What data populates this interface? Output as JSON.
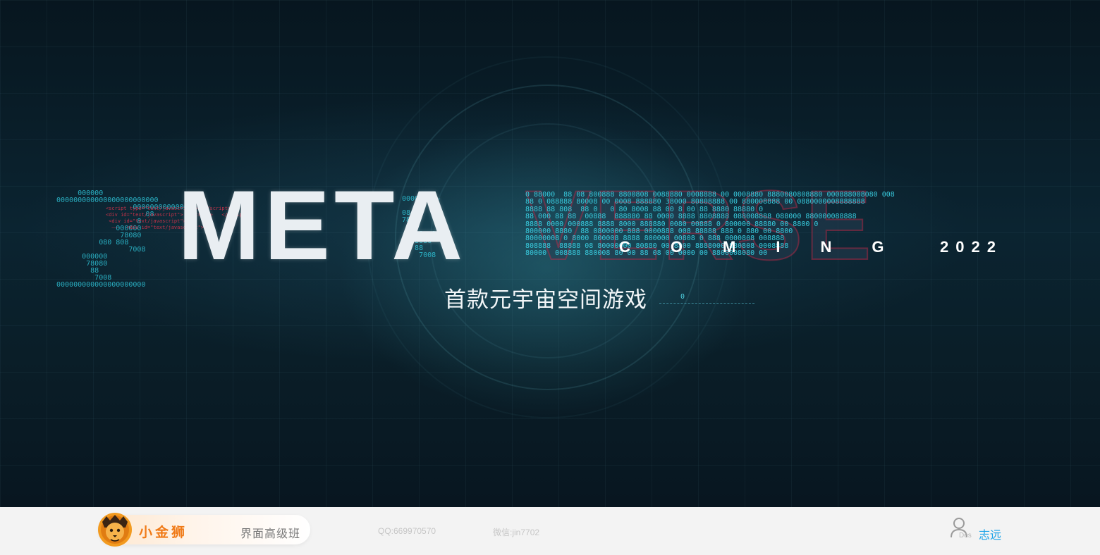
{
  "hero": {
    "meta": "META",
    "verse": "VERSE",
    "coming": "COMING",
    "year": "2022",
    "subtitle": "首款元宇宙空间游戏",
    "subtitle_code": "0",
    "code_left": "     000000\n000000000000000000000000\n                  0000000000000\n                     08\n                   8\n              000000\n               78080\n          080 808\n                 7008\n      000000\n       78080\n        88\n         7008\n000000000000000000000",
    "code_mid": "000000 ——\n\n08\n78\n\n 7008  8\n  78080\n   88\n    7008",
    "code_verse": "0 88000  88 08 800888 8800808 0088880 0008888 00 0008880 8880080808880 000888008080 008\n88 0 088888 80008 00 0008 888880 38000 80808888 00 880008888 00 0880000008888888\n8888 88 808  88 0   0 80 8008 88 00 8 00 88 8880 88880 0\n88 000 88 88  00888  888880 88 0000 8888 8808888 088008888 088000 880000088888\n8888 0000 000888 8888 8000 888880 0080 00888 0 800000 88880 00 8800 0\n800000 8880  88 0800000 888 0000888 008 88888 888 0 880 00 8800\n80000008 0 8000 800008 8888 800000 00808 0 888 0000808 008888\n808888  88888 08 80000000 80880 00 8800 8888000 880808 0008888\n80000  008888 880008 80 00 88 08 00 0000 00 8800008080 00"
  },
  "footer": {
    "brand_name": "小金狮",
    "course": "界面高级班",
    "qq": "QQ:669970570",
    "wechat": "微信:jin7702",
    "des": "Des",
    "author": "志远"
  },
  "colors": {
    "brand_orange": "#f07a17",
    "author_blue": "#1aa3e8",
    "code_cyan": "#2fc4d8",
    "code_red": "#d8334b"
  },
  "icons": [
    "lion-logo-icon",
    "user-icon"
  ]
}
